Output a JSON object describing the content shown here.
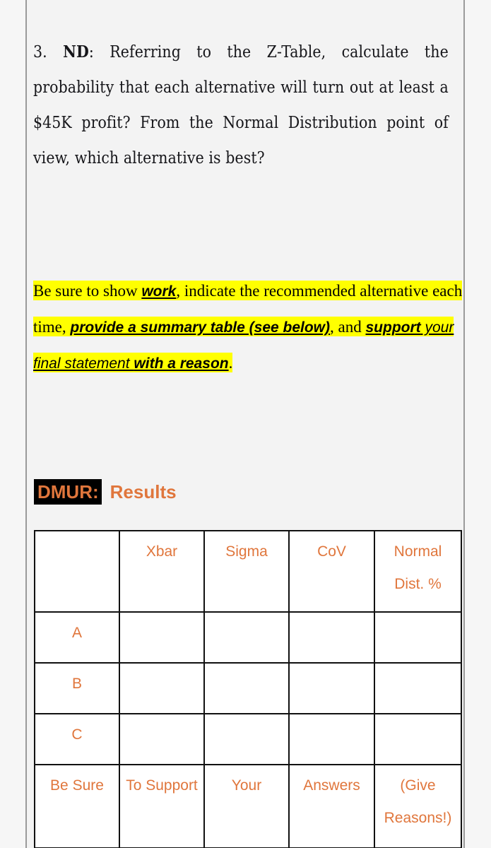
{
  "document": {
    "question": {
      "number": "3.",
      "tag": "ND",
      "body": ": Referring to the Z-Table, calculate the probability that each alternative will turn out at least a $45K profit?   From the Normal Distribution point of view, which alternative is best?"
    },
    "instructions": {
      "seg1": "Be sure to show ",
      "seg2_emph": "work",
      "seg3": ", indicate the recommended alternative each time, ",
      "seg4_emph": "provide a summary table (see below)",
      "seg5": ", and ",
      "seg6_emph": "support",
      "seg7_emph_light": " your final statement ",
      "seg8_emph": "with a reason",
      "seg9": "."
    },
    "dmur_heading": {
      "label": "DMUR:",
      "results": "Results",
      "label_color": "#e0763c",
      "label_background": "#000000"
    },
    "results_table": {
      "accent_color": "#e0763c",
      "border_color": "#111111",
      "columns": [
        "",
        "Xbar",
        "Sigma",
        "CoV",
        "Normal Dist. %"
      ],
      "rows": [
        {
          "label": "A",
          "cells": [
            "",
            "",
            "",
            ""
          ]
        },
        {
          "label": "B",
          "cells": [
            "",
            "",
            "",
            ""
          ]
        },
        {
          "label": "C",
          "cells": [
            "",
            "",
            "",
            ""
          ]
        }
      ],
      "footer": [
        "Be Sure",
        "To Support",
        "Your",
        "Answers",
        "(Give Reasons!)"
      ]
    }
  },
  "colors": {
    "page_background": "#f3f3f3",
    "highlight_yellow": "#ffff00",
    "text": "#16161a"
  }
}
